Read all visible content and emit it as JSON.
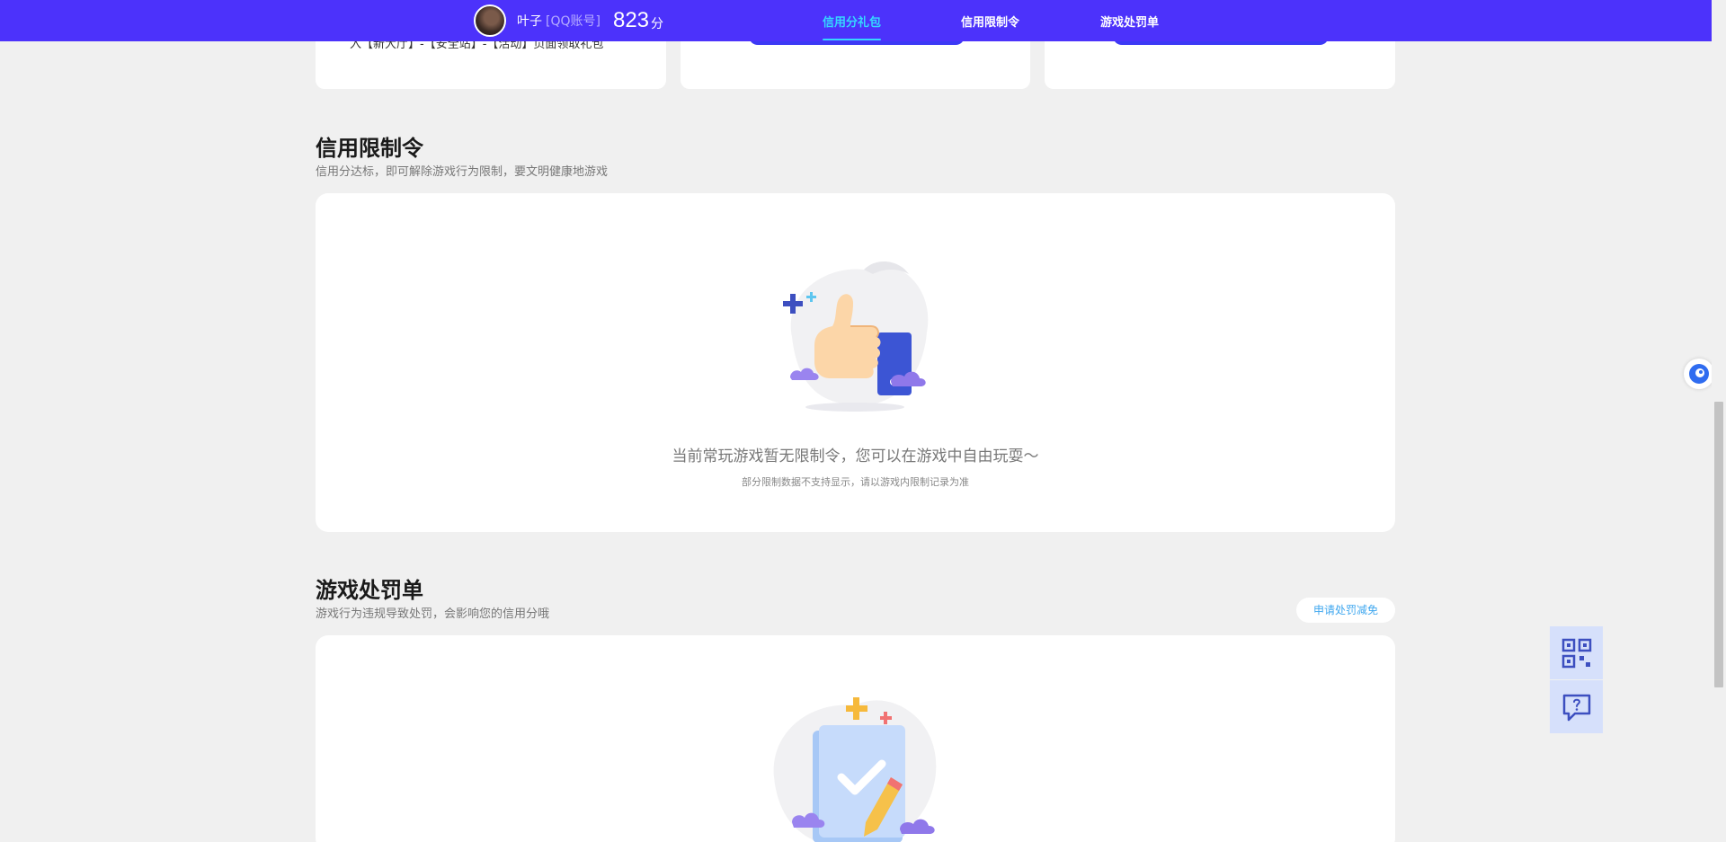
{
  "header": {
    "user_name": "叶子",
    "account_type": "[QQ账号]",
    "score": "823",
    "score_unit": "分",
    "nav": [
      {
        "label": "信用分礼包",
        "active": true
      },
      {
        "label": "信用限制令",
        "active": false
      },
      {
        "label": "游戏处罚单",
        "active": false
      }
    ]
  },
  "top_cards": {
    "first_text": "入【新大厅】-【安全站】-【活动】页面领取礼包"
  },
  "restriction": {
    "title": "信用限制令",
    "subtitle": "信用分达标，即可解除游戏行为限制，要文明健康地游戏",
    "empty_main": "当前常玩游戏暂无限制令，您可以在游戏中自由玩耍～",
    "empty_sub": "部分限制数据不支持显示，请以游戏内限制记录为准"
  },
  "penalty": {
    "title": "游戏处罚单",
    "subtitle": "游戏行为违规导致处罚，会影响您的信用分哦",
    "appeal_button": "申请处罚减免"
  },
  "colors": {
    "header_bg": "#4c32fb",
    "nav_active": "#35d7ff",
    "link_blue": "#3fa7ef"
  }
}
